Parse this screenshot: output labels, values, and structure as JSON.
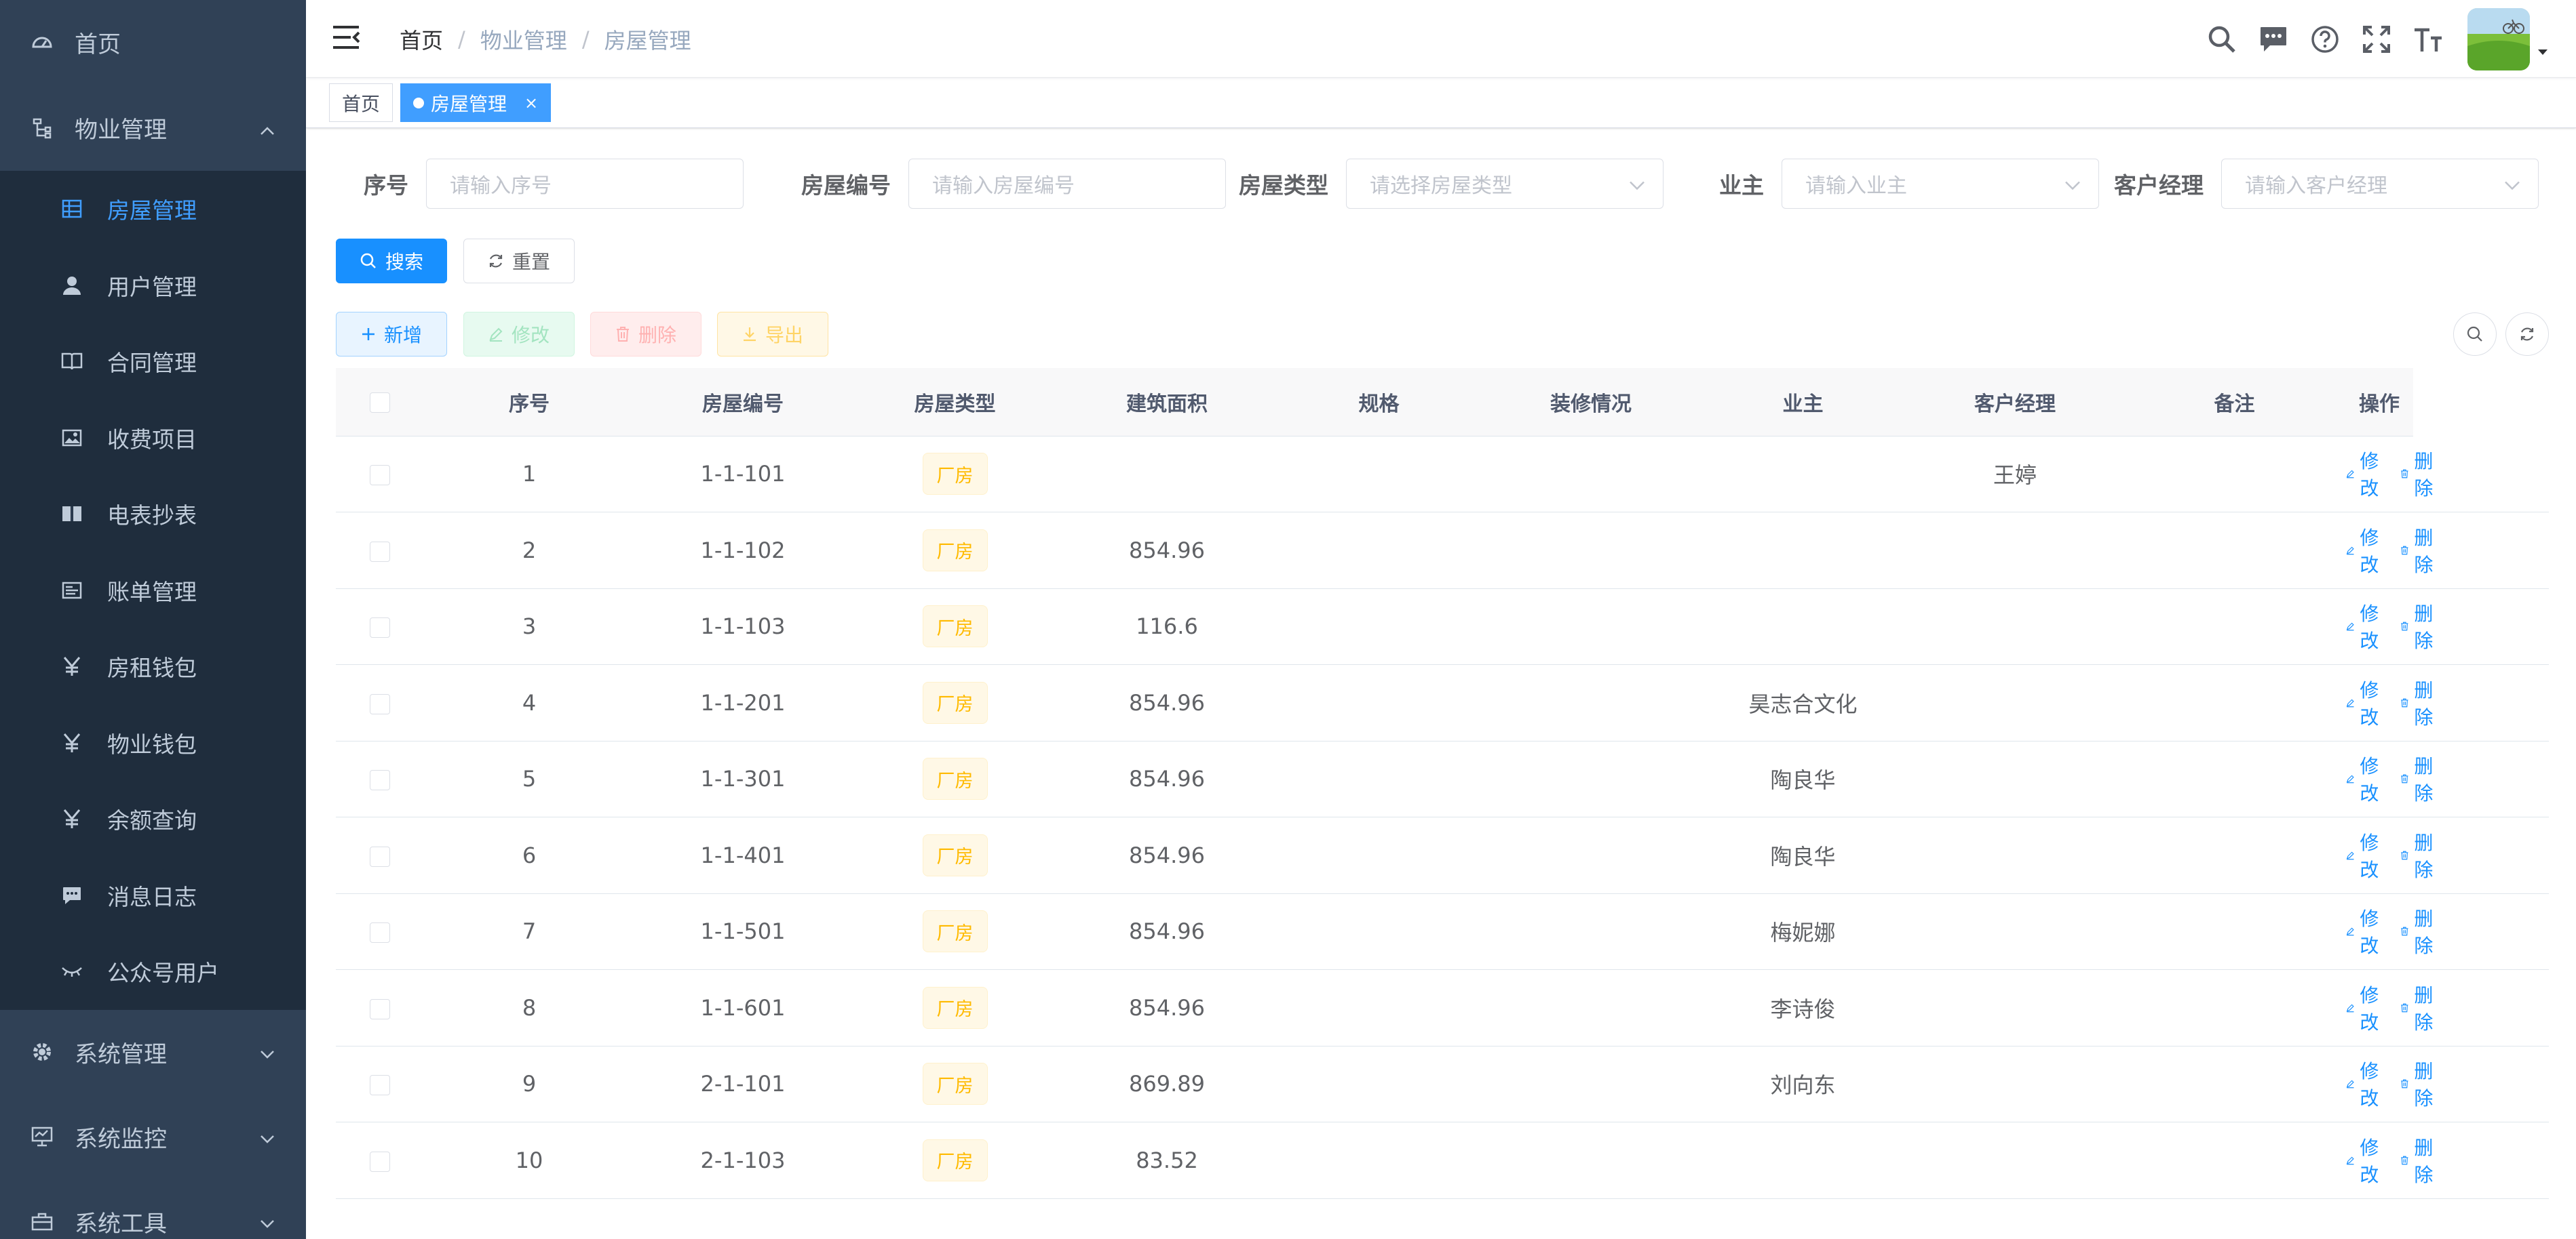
{
  "sidebar": {
    "home": "首页",
    "property_group": "物业管理",
    "items": [
      {
        "label": "房屋管理",
        "icon": "table-icon",
        "active": true
      },
      {
        "label": "用户管理",
        "icon": "user-icon"
      },
      {
        "label": "合同管理",
        "icon": "book-icon"
      },
      {
        "label": "收费项目",
        "icon": "image-icon"
      },
      {
        "label": "电表抄表",
        "icon": "meter-book-icon"
      },
      {
        "label": "账单管理",
        "icon": "bill-icon"
      },
      {
        "label": "房租钱包",
        "icon": "yuan-icon"
      },
      {
        "label": "物业钱包",
        "icon": "yuan-icon"
      },
      {
        "label": "余额查询",
        "icon": "yuan-icon"
      },
      {
        "label": "消息日志",
        "icon": "message-icon"
      },
      {
        "label": "公众号用户",
        "icon": "eye-closed-icon"
      }
    ],
    "system_mgmt": "系统管理",
    "system_monitor": "系统监控",
    "system_tools": "系统工具"
  },
  "navbar": {
    "breadcrumb": [
      "首页",
      "物业管理",
      "房屋管理"
    ],
    "separator": "/"
  },
  "tags": {
    "home": "首页",
    "active": "房屋管理",
    "close": "×"
  },
  "search_form": {
    "serial": {
      "label": "序号",
      "placeholder": "请输入序号"
    },
    "house_no": {
      "label": "房屋编号",
      "placeholder": "请输入房屋编号"
    },
    "house_type": {
      "label": "房屋类型",
      "placeholder": "请选择房屋类型"
    },
    "owner": {
      "label": "业主",
      "placeholder": "请输入业主"
    },
    "manager": {
      "label": "客户经理",
      "placeholder": "请输入客户经理"
    },
    "search_btn": "搜索",
    "reset_btn": "重置"
  },
  "toolbar": {
    "add": "新增",
    "edit": "修改",
    "delete": "删除",
    "export": "导出"
  },
  "table": {
    "headers": [
      "序号",
      "房屋编号",
      "房屋类型",
      "建筑面积",
      "规格",
      "装修情况",
      "业主",
      "客户经理",
      "备注",
      "操作"
    ],
    "edit_label": "修改",
    "delete_label": "删除",
    "rows": [
      {
        "no": "1",
        "code": "1-1-101",
        "type": "厂房",
        "area": "",
        "spec": "",
        "decor": "",
        "owner": "",
        "manager": "王婷",
        "note": ""
      },
      {
        "no": "2",
        "code": "1-1-102",
        "type": "厂房",
        "area": "854.96",
        "spec": "",
        "decor": "",
        "owner": "",
        "manager": "",
        "note": ""
      },
      {
        "no": "3",
        "code": "1-1-103",
        "type": "厂房",
        "area": "116.6",
        "spec": "",
        "decor": "",
        "owner": "",
        "manager": "",
        "note": ""
      },
      {
        "no": "4",
        "code": "1-1-201",
        "type": "厂房",
        "area": "854.96",
        "spec": "",
        "decor": "",
        "owner": "昊志合文化",
        "manager": "",
        "note": ""
      },
      {
        "no": "5",
        "code": "1-1-301",
        "type": "厂房",
        "area": "854.96",
        "spec": "",
        "decor": "",
        "owner": "陶良华",
        "manager": "",
        "note": ""
      },
      {
        "no": "6",
        "code": "1-1-401",
        "type": "厂房",
        "area": "854.96",
        "spec": "",
        "decor": "",
        "owner": "陶良华",
        "manager": "",
        "note": ""
      },
      {
        "no": "7",
        "code": "1-1-501",
        "type": "厂房",
        "area": "854.96",
        "spec": "",
        "decor": "",
        "owner": "梅妮娜",
        "manager": "",
        "note": ""
      },
      {
        "no": "8",
        "code": "1-1-601",
        "type": "厂房",
        "area": "854.96",
        "spec": "",
        "decor": "",
        "owner": "李诗俊",
        "manager": "",
        "note": ""
      },
      {
        "no": "9",
        "code": "2-1-101",
        "type": "厂房",
        "area": "869.89",
        "spec": "",
        "decor": "",
        "owner": "刘向东",
        "manager": "",
        "note": ""
      },
      {
        "no": "10",
        "code": "2-1-103",
        "type": "厂房",
        "area": "83.52",
        "spec": "",
        "decor": "",
        "owner": "",
        "manager": "",
        "note": ""
      }
    ]
  },
  "colors": {
    "sidebar_bg": "#304156",
    "submenu_bg": "#1f2d3d",
    "primary": "#1890ff",
    "tag_warning": "#ffba00"
  }
}
